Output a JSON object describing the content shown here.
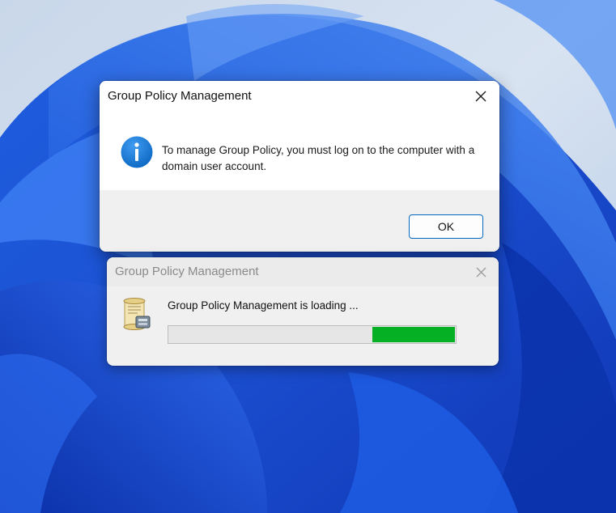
{
  "desktop": {
    "background_color": "#2b6ae0"
  },
  "message_dialog": {
    "title": "Group Policy Management",
    "message": "To manage Group Policy, you must log on to the computer with a domain user account.",
    "ok_label": "OK",
    "icon": "info-icon",
    "accent_color": "#0067c0"
  },
  "loading_dialog": {
    "title": "Group Policy Management",
    "loading_text": "Group Policy Management is loading ...",
    "icon": "scroll-icon",
    "progress": {
      "indeterminate": true,
      "fill_start_fraction": 0.71,
      "fill_end_fraction": 1.0,
      "fill_color": "#06b025"
    }
  }
}
